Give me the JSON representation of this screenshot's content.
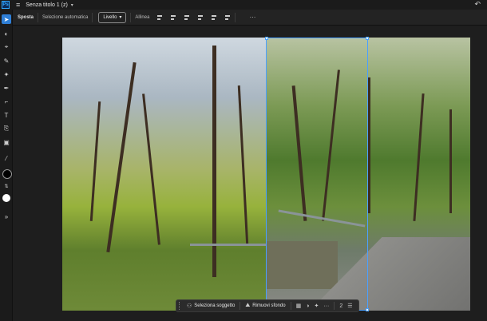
{
  "app": {
    "logo": "Ps",
    "menu_icon": "hamburger-icon",
    "doc_title": "Senza titolo 1 (z)",
    "back_icon": "undo-icon"
  },
  "options": {
    "tool_label": "Sposta",
    "auto_select": "Selezione automatica",
    "layer_select": "Livello",
    "align_label": "Allinea",
    "more": "···"
  },
  "toolbar": {
    "tools": [
      "move-icon",
      "artboard-icon",
      "lasso-icon",
      "brush-icon",
      "quick-selection-icon",
      "pen-icon",
      "crop-icon",
      "text-icon",
      "clone-icon",
      "fill-icon",
      "eyedropper-icon"
    ],
    "fg_color": "#000000",
    "bg_color": "#ffffff",
    "expand": "»"
  },
  "taskbar": {
    "select_subject": "Seleziona soggetto",
    "remove_bg": "Rimuovi sfondo",
    "more": "···",
    "count": "2"
  },
  "colors": {
    "accent": "#2f7fd6",
    "selection": "#4aa0ff"
  }
}
